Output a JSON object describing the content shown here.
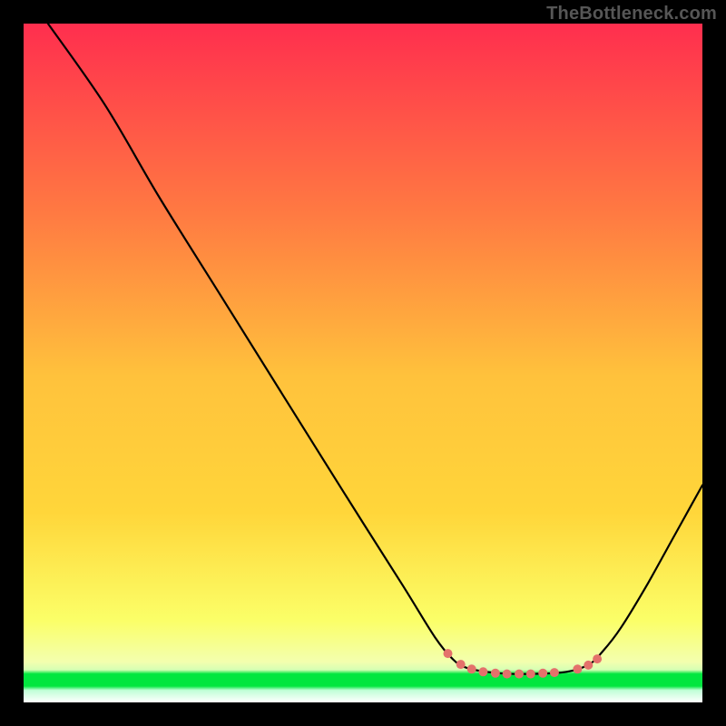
{
  "watermark": "TheBottleneck.com",
  "chart_data": {
    "type": "line",
    "title": "",
    "xlabel": "",
    "ylabel": "",
    "xrange": [
      0,
      100
    ],
    "yrange": [
      0,
      100
    ],
    "background_gradient": {
      "top": "#ff2e4e",
      "mid_upper": "#ff9a3c",
      "mid": "#ffd63a",
      "mid_lower": "#fff95a",
      "green_band": "#02e63f",
      "bottom": "#ffffff"
    },
    "series": [
      {
        "name": "curve",
        "color": "#000000",
        "points": [
          {
            "x": 3.6,
            "y": 100.0
          },
          {
            "x": 12.0,
            "y": 88.0
          },
          {
            "x": 20.0,
            "y": 74.4
          },
          {
            "x": 29.0,
            "y": 60.0
          },
          {
            "x": 38.0,
            "y": 45.6
          },
          {
            "x": 47.0,
            "y": 31.2
          },
          {
            "x": 56.0,
            "y": 17.0
          },
          {
            "x": 60.6,
            "y": 9.6
          },
          {
            "x": 63.2,
            "y": 6.4
          },
          {
            "x": 65.3,
            "y": 5.1
          },
          {
            "x": 70.0,
            "y": 4.3
          },
          {
            "x": 75.0,
            "y": 4.2
          },
          {
            "x": 80.0,
            "y": 4.5
          },
          {
            "x": 83.3,
            "y": 5.6
          },
          {
            "x": 85.3,
            "y": 7.5
          },
          {
            "x": 88.0,
            "y": 11.0
          },
          {
            "x": 92.0,
            "y": 17.6
          },
          {
            "x": 96.0,
            "y": 24.8
          },
          {
            "x": 100.0,
            "y": 32.0
          }
        ]
      },
      {
        "name": "dots",
        "color": "#e4716b",
        "radius_px": 5,
        "points": [
          {
            "x": 62.5,
            "y": 7.2
          },
          {
            "x": 64.4,
            "y": 5.6
          },
          {
            "x": 66.0,
            "y": 4.9
          },
          {
            "x": 67.7,
            "y": 4.5
          },
          {
            "x": 69.5,
            "y": 4.3
          },
          {
            "x": 71.2,
            "y": 4.2
          },
          {
            "x": 73.0,
            "y": 4.2
          },
          {
            "x": 74.7,
            "y": 4.2
          },
          {
            "x": 76.5,
            "y": 4.3
          },
          {
            "x": 78.2,
            "y": 4.4
          },
          {
            "x": 81.6,
            "y": 4.9
          },
          {
            "x": 83.2,
            "y": 5.5
          },
          {
            "x": 84.5,
            "y": 6.4
          }
        ]
      }
    ]
  }
}
